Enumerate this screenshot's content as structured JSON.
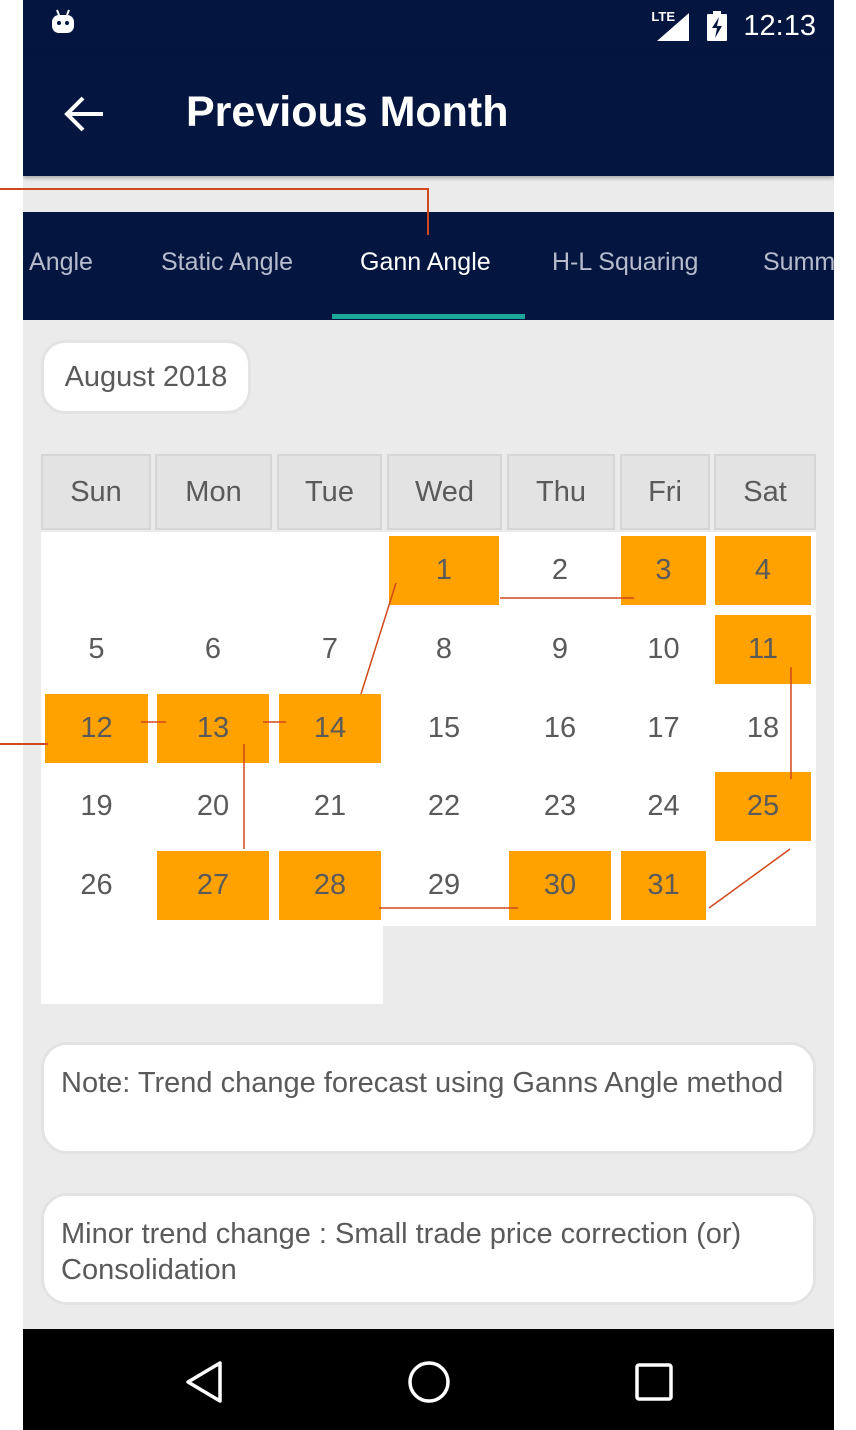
{
  "status_bar": {
    "time": "12:13",
    "network": "LTE"
  },
  "app_bar": {
    "title": "Previous Month"
  },
  "tabs": [
    {
      "label": "Calendar Angle",
      "active": false
    },
    {
      "label": "Static Angle",
      "active": false
    },
    {
      "label": "Gann Angle",
      "active": true
    },
    {
      "label": "H-L Squaring",
      "active": false
    },
    {
      "label": "Summary",
      "active": false
    }
  ],
  "calendar": {
    "month_label": "August 2018",
    "weekdays": [
      "Sun",
      "Mon",
      "Tue",
      "Wed",
      "Thu",
      "Fri",
      "Sat"
    ],
    "days": [
      {
        "day": "1",
        "hl": true
      },
      {
        "day": "2",
        "hl": false
      },
      {
        "day": "3",
        "hl": true
      },
      {
        "day": "4",
        "hl": true
      },
      {
        "day": "5",
        "hl": false
      },
      {
        "day": "6",
        "hl": false
      },
      {
        "day": "7",
        "hl": false
      },
      {
        "day": "8",
        "hl": false
      },
      {
        "day": "9",
        "hl": false
      },
      {
        "day": "10",
        "hl": false
      },
      {
        "day": "11",
        "hl": true
      },
      {
        "day": "12",
        "hl": true
      },
      {
        "day": "13",
        "hl": true
      },
      {
        "day": "14",
        "hl": true
      },
      {
        "day": "15",
        "hl": false
      },
      {
        "day": "16",
        "hl": false
      },
      {
        "day": "17",
        "hl": false
      },
      {
        "day": "18",
        "hl": false
      },
      {
        "day": "19",
        "hl": false
      },
      {
        "day": "20",
        "hl": false
      },
      {
        "day": "21",
        "hl": false
      },
      {
        "day": "22",
        "hl": false
      },
      {
        "day": "23",
        "hl": false
      },
      {
        "day": "24",
        "hl": false
      },
      {
        "day": "25",
        "hl": true
      },
      {
        "day": "26",
        "hl": false
      },
      {
        "day": "27",
        "hl": true
      },
      {
        "day": "28",
        "hl": true
      },
      {
        "day": "29",
        "hl": false
      },
      {
        "day": "30",
        "hl": true
      },
      {
        "day": "31",
        "hl": true
      }
    ],
    "highlight_color": "#ffa200",
    "line_color": "#d0481c"
  },
  "notes": {
    "note1": "Note: Trend change forecast using Ganns Angle method",
    "note2": "Minor trend change : Small trade price correction (or) Consolidation"
  },
  "colors": {
    "primary": "#041640",
    "tab_indicator": "#1ca99a"
  },
  "icons": [
    "android-icon",
    "lte-signal-icon",
    "battery-charging-icon",
    "back-arrow-icon",
    "nav-back-icon",
    "nav-home-icon",
    "nav-recents-icon"
  ]
}
